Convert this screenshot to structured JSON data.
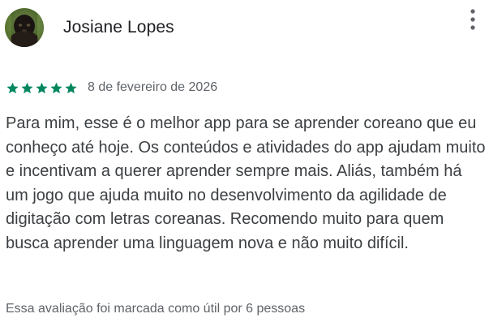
{
  "reviewer": {
    "name": "Josiane Lopes",
    "avatar_icon": "user-avatar-photo"
  },
  "menu": {
    "icon": "more-vert-icon"
  },
  "rating": {
    "stars": 5,
    "max": 5,
    "color": "#01875f",
    "icon": "star-icon"
  },
  "review": {
    "date": "8 de fevereiro de 2026",
    "text": "Para mim, esse é o melhor app para se aprender coreano que eu conheço até hoje. Os conteúdos e atividades do app ajudam muito e incentivam a querer aprender sempre mais. Aliás, também há um jogo que ajuda muito no desenvolvimento da agilidade de digitação com letras coreanas. Recomendo muito para quem busca aprender uma linguagem nova e não muito difícil.",
    "helpful": "Essa avaliação foi marcada como útil por 6 pessoas"
  }
}
